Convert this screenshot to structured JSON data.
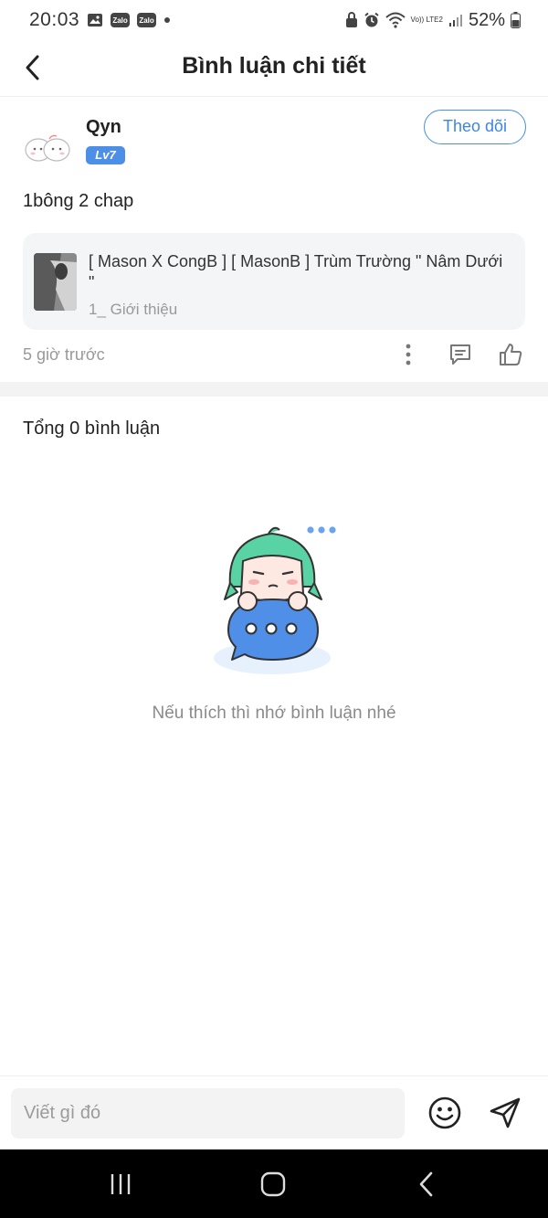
{
  "status_bar": {
    "time": "20:03",
    "zalo_label_1": "Zalo",
    "zalo_label_2": "Zalo",
    "volte": "Vo)) LTE2",
    "battery": "52%"
  },
  "header": {
    "title": "Bình luận chi tiết",
    "back_icon": "chevron-left-icon"
  },
  "post": {
    "author_name": "Qyn",
    "level": "Lv7",
    "follow_label": "Theo dõi",
    "text": "1bông 2 chap",
    "linked": {
      "title": "[ Mason X CongB ] [ MasonB ] Trùm Trường \" Nâm Dưới \"",
      "subtitle": "1_ Giới thiệu"
    },
    "time_ago": "5 giờ trước"
  },
  "comments": {
    "total_label": "Tổng 0 bình luận",
    "empty_text": "Nếu thích thì nhớ bình luận nhé"
  },
  "composer": {
    "placeholder": "Viết gì đó"
  },
  "colors": {
    "accent": "#4a8fe0",
    "badge": "#4d8fe6",
    "mascot_hair": "#5ad3a4",
    "mascot_bubble": "#4f8fe8"
  }
}
